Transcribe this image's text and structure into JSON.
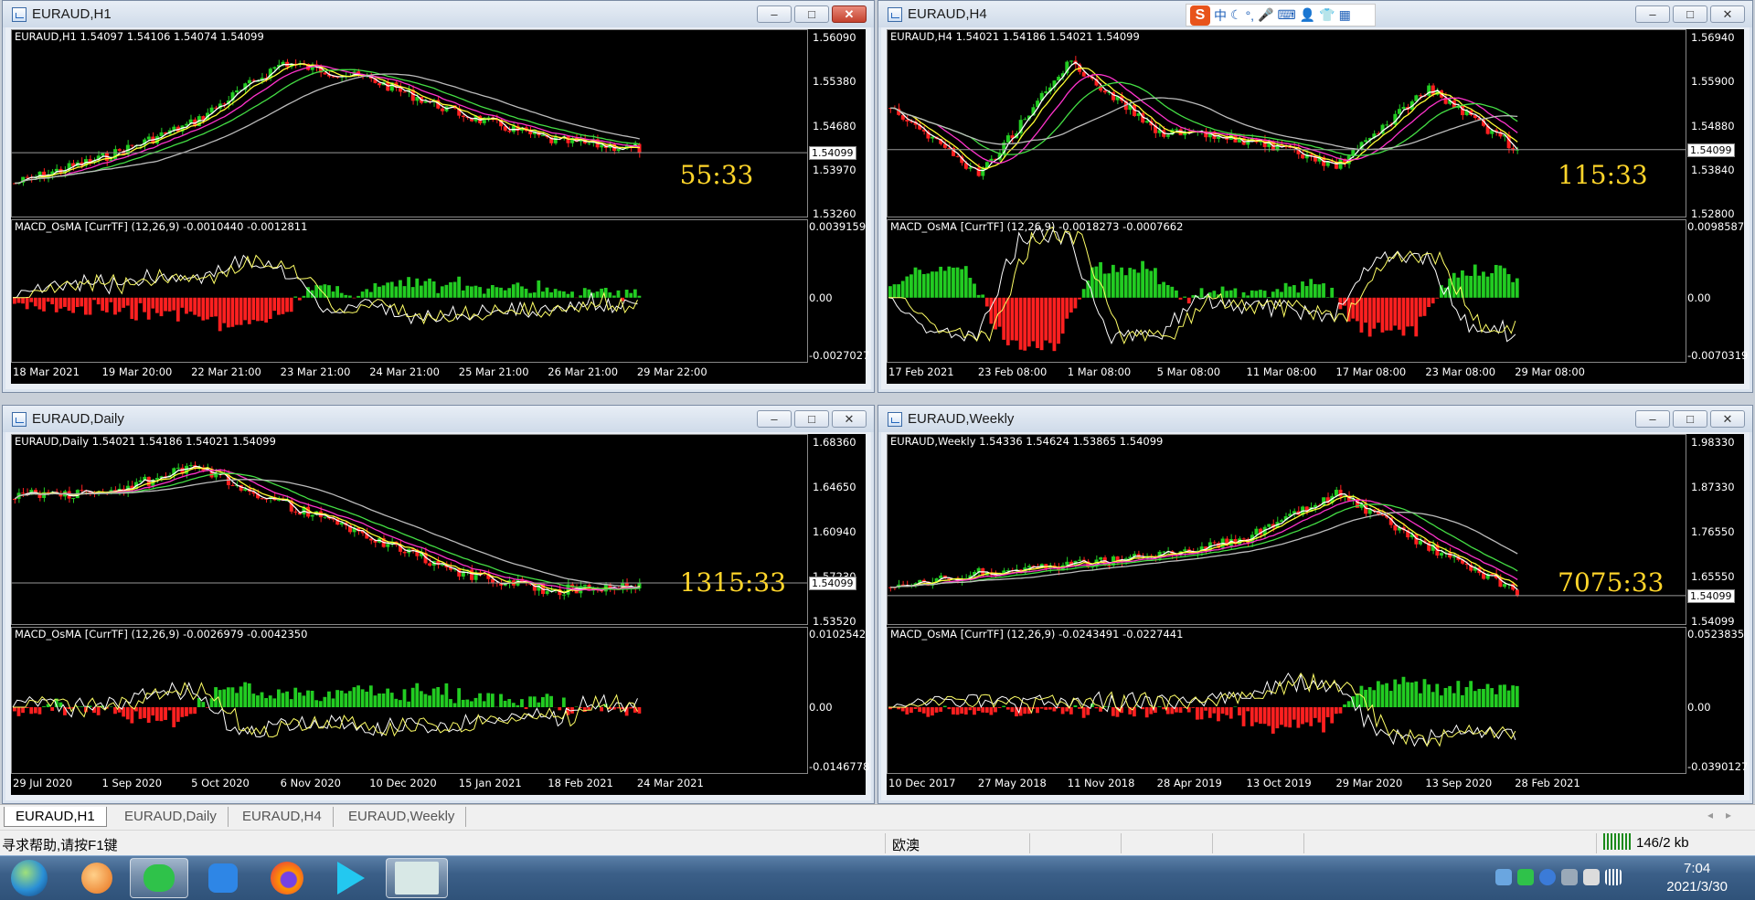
{
  "windows": [
    {
      "title": "EURAUD,H1",
      "header": "EURAUD,H1  1.54097 1.54106 1.54074 1.54099",
      "prices": [
        "1.56090",
        "1.55380",
        "1.54680",
        "1.53970",
        "1.53260"
      ],
      "current_price": "1.54099",
      "timer": "55:33",
      "macd_label": "MACD_OsMA [CurrTF] (12,26,9) -0.0010440 -0.0012811",
      "macd_levels": [
        "0.0039159",
        "0.00",
        "-0.0027027"
      ],
      "dates": [
        "18 Mar 2021",
        "19 Mar 20:00",
        "22 Mar 21:00",
        "23 Mar 21:00",
        "24 Mar 21:00",
        "25 Mar 21:00",
        "26 Mar 21:00",
        "29 Mar 22:00"
      ]
    },
    {
      "title": "EURAUD,H4",
      "header": "EURAUD,H4  1.54021 1.54186 1.54021 1.54099",
      "prices": [
        "1.56940",
        "1.55900",
        "1.54880",
        "1.53840",
        "1.52800"
      ],
      "current_price": "1.54099",
      "timer": "115:33",
      "macd_label": "MACD_OsMA [CurrTF] (12,26,9) -0.0018273 -0.0007662",
      "macd_levels": [
        "0.0098587",
        "0.00",
        "-0.0070319"
      ],
      "dates": [
        "17 Feb 2021",
        "23 Feb 08:00",
        "1 Mar 08:00",
        "5 Mar 08:00",
        "11 Mar 08:00",
        "17 Mar 08:00",
        "23 Mar 08:00",
        "29 Mar 08:00"
      ]
    },
    {
      "title": "EURAUD,Daily",
      "header": "EURAUD,Daily  1.54021 1.54186 1.54021 1.54099",
      "prices": [
        "1.68360",
        "1.64650",
        "1.60940",
        "1.57230",
        "1.53520"
      ],
      "current_price": "1.54099",
      "timer": "1315:33",
      "macd_label": "MACD_OsMA [CurrTF] (12,26,9) -0.0026979 -0.0042350",
      "macd_levels": [
        "0.0102542",
        "0.00",
        "-0.0146778"
      ],
      "dates": [
        "29 Jul 2020",
        "1 Sep 2020",
        "5 Oct 2020",
        "6 Nov 2020",
        "10 Dec 2020",
        "15 Jan 2021",
        "18 Feb 2021",
        "24 Mar 2021"
      ]
    },
    {
      "title": "EURAUD,Weekly",
      "header": "EURAUD,Weekly  1.54336 1.54624 1.53865 1.54099",
      "prices": [
        "1.98330",
        "1.87330",
        "1.76550",
        "1.65550",
        "1.54099"
      ],
      "current_price": "1.54099",
      "timer": "7075:33",
      "macd_label": "MACD_OsMA [CurrTF] (12,26,9) -0.0243491 -0.0227441",
      "macd_levels": [
        "0.0523835",
        "0.00",
        "-0.0390127"
      ],
      "dates": [
        "10 Dec 2017",
        "27 May 2018",
        "11 Nov 2018",
        "28 Apr 2019",
        "13 Oct 2019",
        "29 Mar 2020",
        "13 Sep 2020",
        "28 Feb 2021"
      ]
    }
  ],
  "tabs": [
    "EURAUD,H1",
    "EURAUD,Daily",
    "EURAUD,H4",
    "EURAUD,Weekly"
  ],
  "status": {
    "help": "寻求帮助,请按F1键",
    "profile": "欧澳",
    "traffic": "146/2 kb"
  },
  "ime": {
    "lang": "中"
  },
  "clock": {
    "time": "7:04",
    "date": "2021/3/30"
  },
  "colors": {
    "bull": "#ff2020",
    "bear": "#22cc22",
    "ma_white": "#ffffff",
    "ma_yellow": "#ffff33",
    "ma_magenta": "#ff33cc",
    "ma_green": "#44dd44",
    "ma_gray": "#bbbbbb",
    "timer": "#ffd52a"
  }
}
